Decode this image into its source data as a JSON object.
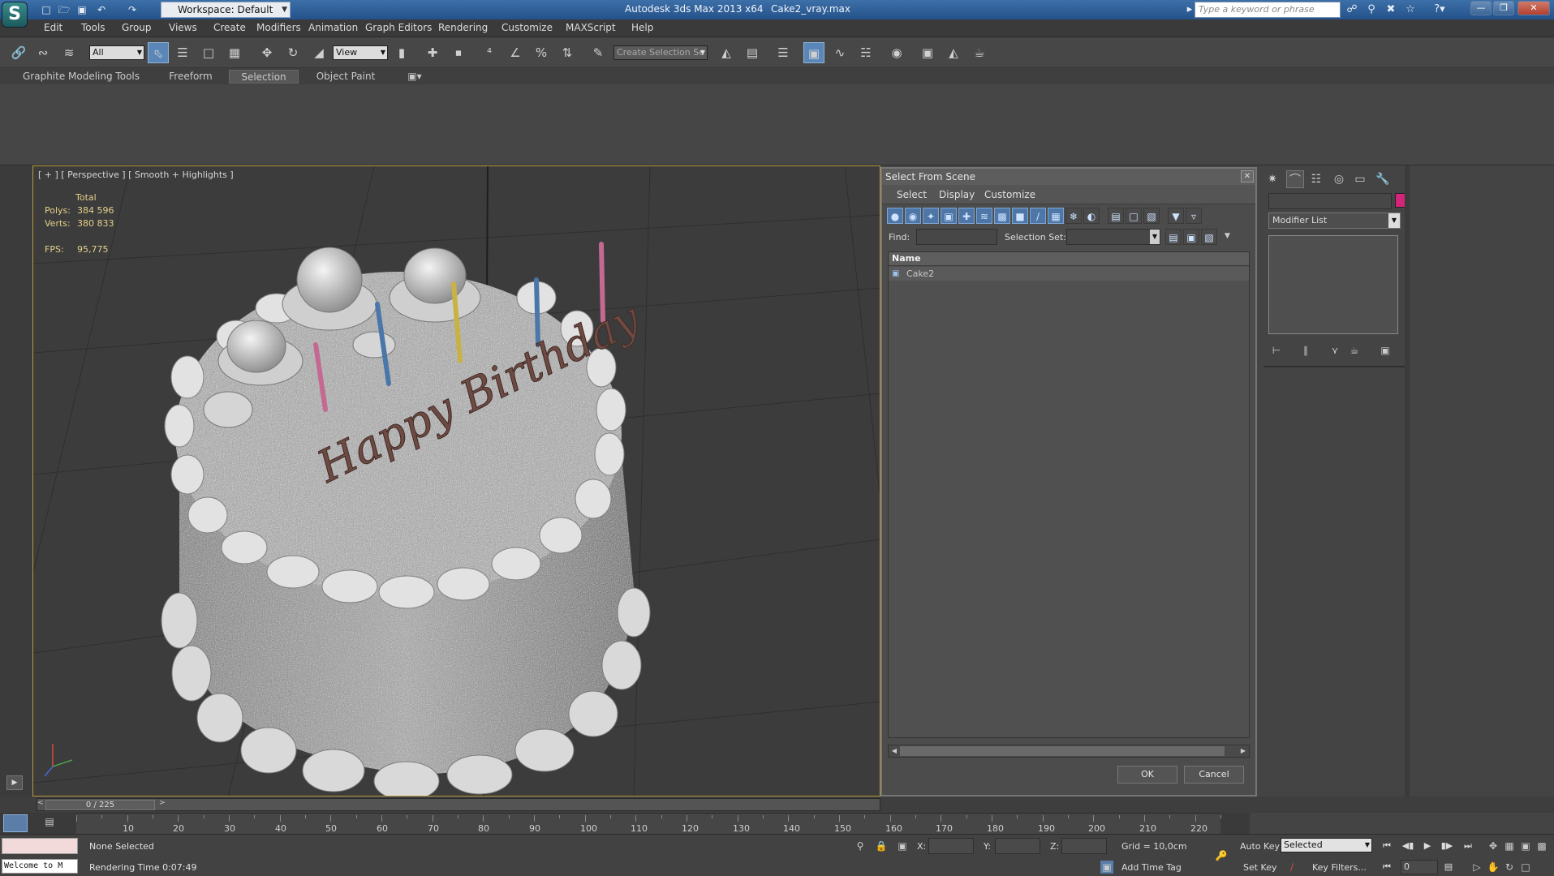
{
  "titlebar": {
    "workspace": "Workspace: Default",
    "app_title": "Autodesk 3ds Max  2013 x64",
    "file_title": "Cake2_vray.max",
    "search_placeholder": "Type a keyword or phrase"
  },
  "menu": [
    "Edit",
    "Tools",
    "Group",
    "Views",
    "Create",
    "Modifiers",
    "Animation",
    "Graph Editors",
    "Rendering",
    "Customize",
    "MAXScript",
    "Help"
  ],
  "toolbar": {
    "filter_value": "All",
    "ref_coord_value": "View",
    "selection_set_placeholder": "Create Selection Se"
  },
  "ribbon_tabs": [
    "Graphite Modeling Tools",
    "Freeform",
    "Selection",
    "Object Paint"
  ],
  "viewport": {
    "label": "[ + ] [ Perspective ] [ Smooth + Highlights ]",
    "stats": {
      "total_label": "Total",
      "polys_label": "Polys:",
      "polys_value": "384 596",
      "verts_label": "Verts:",
      "verts_value": "380 833",
      "fps_label": "FPS:",
      "fps_value": "95,775"
    },
    "scene_text": "Happy Birthday"
  },
  "dialog": {
    "title": "Select From Scene",
    "menu": [
      "Select",
      "Display",
      "Customize"
    ],
    "find_label": "Find:",
    "find_value": "",
    "selection_set_label": "Selection Set:",
    "column_name": "Name",
    "items": [
      "Cake2"
    ],
    "ok_label": "OK",
    "cancel_label": "Cancel"
  },
  "command_panel": {
    "modifier_list": "Modifier List",
    "object_color": "#d4247a"
  },
  "timeline": {
    "slider_label": "0 / 225",
    "ticks": [
      "10",
      "20",
      "30",
      "40",
      "50",
      "60",
      "70",
      "80",
      "90",
      "100",
      "110",
      "120",
      "130",
      "140",
      "150",
      "160",
      "170",
      "180",
      "190",
      "200",
      "210",
      "220"
    ]
  },
  "status": {
    "maxscript_text": "Welcome to M",
    "selection_status": "None Selected",
    "render_time": "Rendering Time  0:07:49",
    "x_label": "X:",
    "y_label": "Y:",
    "z_label": "Z:",
    "grid": "Grid = 10,0cm",
    "add_time_tag": "Add Time Tag",
    "auto_key": "Auto Key",
    "set_key": "Set Key",
    "selected_value": "Selected",
    "key_filters": "Key Filters...",
    "frame_value": "0"
  }
}
